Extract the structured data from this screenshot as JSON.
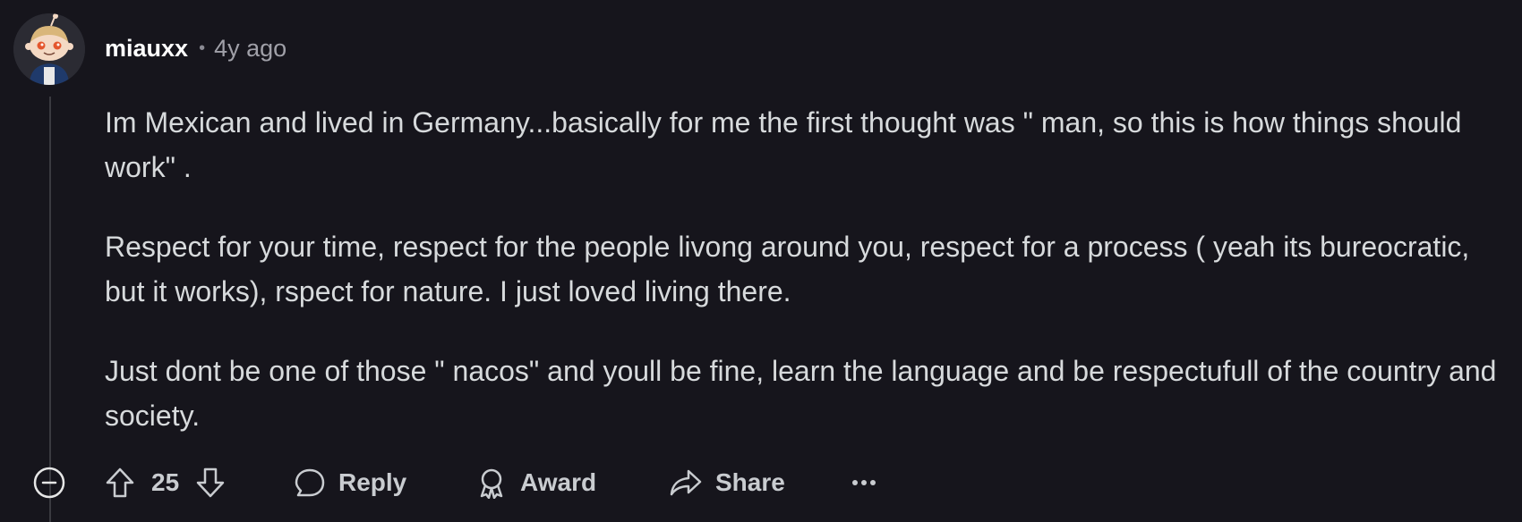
{
  "comment": {
    "username": "miauxx",
    "timestamp": "4y ago",
    "paragraphs": [
      "Im Mexican and lived in Germany...basically for me the first thought was \" man, so this is how things should work\" .",
      "Respect for your time, respect for the people livong around you, respect for a process ( yeah its bureocratic, but it works), rspect for nature. I just loved living there.",
      "Just dont be one of those \" nacos\" and youll be fine, learn the language and be respectufull of the country and society."
    ],
    "vote_count": "25",
    "reply_label": "Reply",
    "award_label": "Award",
    "share_label": "Share"
  },
  "icons": {
    "collapse": "minus-circle-icon",
    "upvote": "arrow-up-icon",
    "downvote": "arrow-down-icon",
    "reply": "speech-bubble-icon",
    "award": "award-ribbon-icon",
    "share": "share-arrow-icon",
    "more": "more-horizontal-icon"
  },
  "colors": {
    "background": "#16151c",
    "text": "#d7dadc",
    "muted": "#a0a0a8"
  }
}
